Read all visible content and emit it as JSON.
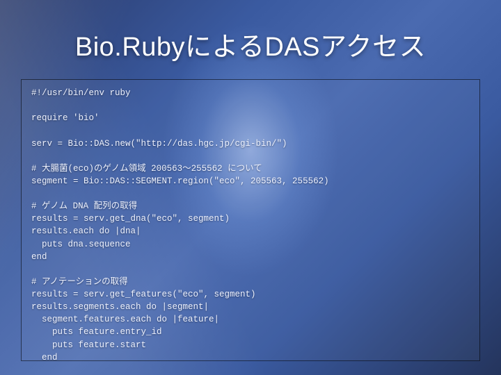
{
  "slide": {
    "title": "Bio.RubyによるDASアクセス",
    "code": "#!/usr/bin/env ruby\n\nrequire 'bio'\n\nserv = Bio::DAS.new(\"http://das.hgc.jp/cgi-bin/\")\n\n# 大腸菌(eco)のゲノム領域 200563〜255562 について\nsegment = Bio::DAS::SEGMENT.region(\"eco\", 205563, 255562)\n\n# ゲノム DNA 配列の取得\nresults = serv.get_dna(\"eco\", segment)\nresults.each do |dna|\n  puts dna.sequence\nend\n\n# アノテーションの取得\nresults = serv.get_features(\"eco\", segment)\nresults.segments.each do |segment|\n  segment.features.each do |feature|\n    puts feature.entry_id\n    puts feature.start\n  end\nend"
  }
}
